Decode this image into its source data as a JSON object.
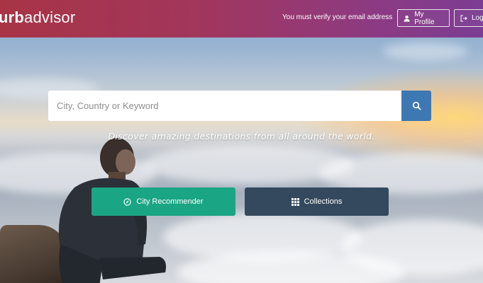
{
  "header": {
    "logo_bold": "urb",
    "logo_light": "advisor",
    "verify_notice": "You must verify your email address",
    "profile_label": "My Profile",
    "logout_label": "Log"
  },
  "search": {
    "placeholder": "City, Country or Keyword"
  },
  "hero": {
    "tagline": "Discover amazing destinations from all around the world."
  },
  "actions": {
    "recommender_label": "City Recommender",
    "collections_label": "Collections"
  },
  "colors": {
    "header_start": "#a83446",
    "header_end": "#7b3d93",
    "search_button": "#3e78b2",
    "recommender": "#1aa584",
    "collections": "#34495e"
  },
  "icons": {
    "profile": "user-icon",
    "logout": "sign-out-icon",
    "search": "search-icon",
    "recommender": "compass-icon",
    "collections": "grid-icon"
  }
}
